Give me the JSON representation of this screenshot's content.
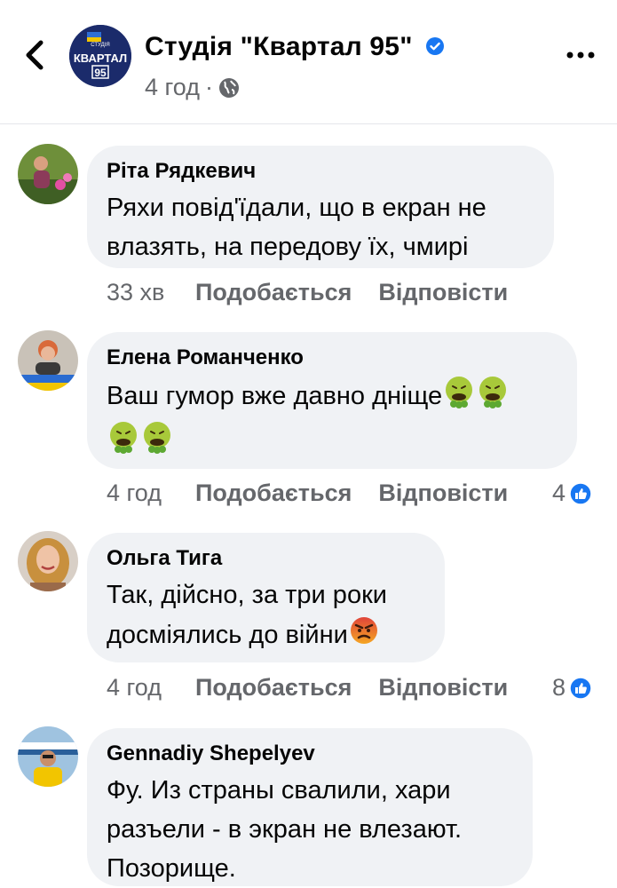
{
  "header": {
    "page_name": "Студія \"Квартал 95\"",
    "logo_text_top": "СТУДІЯ",
    "logo_text_main": "КВАРТАЛ",
    "logo_text_num": "95",
    "time": "4 год",
    "separator": "·",
    "icons": {
      "back": "chevron-left-icon",
      "verified": "verified-badge-icon",
      "audience": "globe-icon",
      "more": "more-dots-icon"
    },
    "colors": {
      "logo_bg": "#1b2b6b",
      "verified": "#1877f2"
    }
  },
  "comments": [
    {
      "author": "Ріта Рядкевич",
      "text": "Ряхи повід'їдали, що в екран не влазять, на передову їх, чмирі",
      "time": "33 хв",
      "like_label": "Подобається",
      "reply_label": "Відповісти",
      "reactions": null
    },
    {
      "author": "Елена Романченко",
      "text": "Ваш гумор вже давно дніще",
      "emojis": [
        "nauseated-face",
        "nauseated-face",
        "nauseated-face",
        "nauseated-face"
      ],
      "time": "4 год",
      "like_label": "Подобається",
      "reply_label": "Відповісти",
      "reactions": {
        "count": "4",
        "icon": "like-reaction-icon"
      }
    },
    {
      "author": "Ольга Тига",
      "text_line1": "Так, дійсно, за три роки",
      "text_line2": "досміялись до війни",
      "emojis": [
        "angry-face"
      ],
      "time": "4 год",
      "like_label": "Подобається",
      "reply_label": "Відповісти",
      "reactions": {
        "count": "8",
        "icon": "like-reaction-icon"
      }
    },
    {
      "author": "Gennadiy Shepelyev",
      "text_line1": "Фу. Из страны свалили, хари",
      "text_line2": "разъели - в экран не влезают.",
      "text_line3": "Позорище."
    }
  ]
}
